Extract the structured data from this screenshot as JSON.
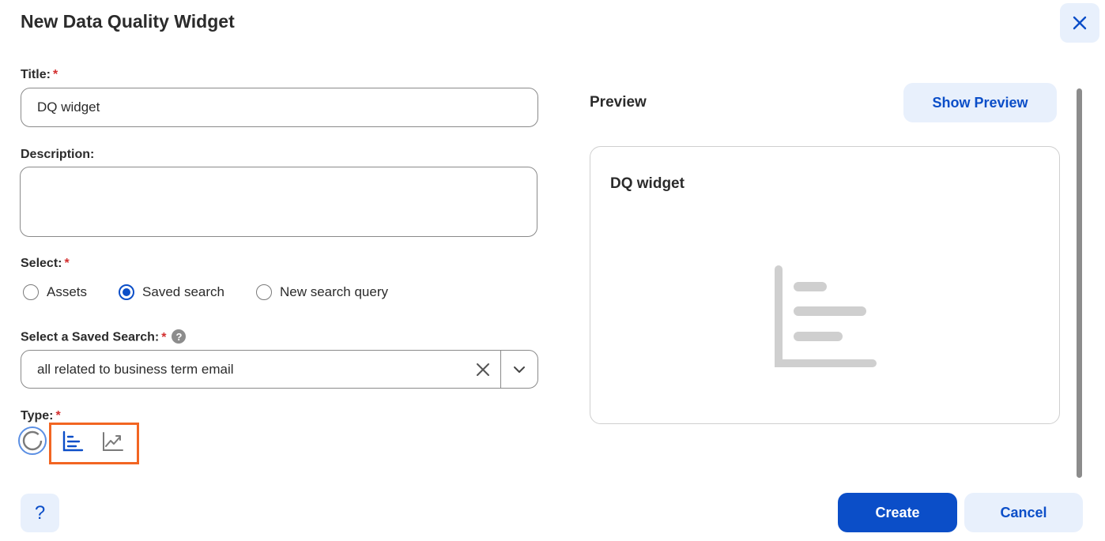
{
  "dialog": {
    "title": "New Data Quality Widget",
    "close_icon": "close-icon"
  },
  "form": {
    "title_label": "Title:",
    "title_value": "DQ widget",
    "required_mark": "*",
    "description_label": "Description:",
    "description_value": "",
    "select_label": "Select:",
    "select_options": [
      {
        "label": "Assets",
        "selected": false
      },
      {
        "label": "Saved search",
        "selected": true
      },
      {
        "label": "New search query",
        "selected": false
      }
    ],
    "saved_search_label": "Select a Saved Search:",
    "saved_search_help": "?",
    "saved_search_value": "all related to business term email",
    "type_label": "Type:",
    "type_options": [
      {
        "icon": "donut-chart-icon",
        "selected": false
      },
      {
        "icon": "horizontal-bar-chart-icon",
        "selected": true
      },
      {
        "icon": "trend-line-chart-icon",
        "selected": false
      }
    ]
  },
  "preview": {
    "heading": "Preview",
    "show_button": "Show Preview",
    "card_title": "DQ widget",
    "placeholder_icon": "horizontal-bar-chart-placeholder-icon"
  },
  "footer": {
    "help_label": "?",
    "create_label": "Create",
    "cancel_label": "Cancel"
  },
  "colors": {
    "primary": "#0b4ec8",
    "button_secondary_bg": "#e8f0fc",
    "required": "#d32f2f",
    "highlight": "#f26522"
  }
}
